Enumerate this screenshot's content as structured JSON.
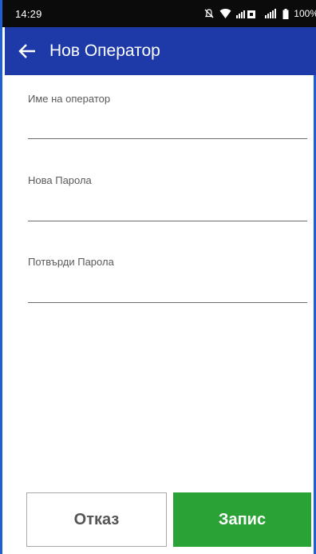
{
  "status_bar": {
    "time": "14:29",
    "battery": "100%",
    "icons": [
      "mute-icon",
      "wifi-icon",
      "signal-icon",
      "signal-icon",
      "battery-icon"
    ]
  },
  "app_bar": {
    "title": "Нов Оператор",
    "back_icon": "arrow-left-icon",
    "color": "#1d3aa8"
  },
  "form": {
    "operator_name": {
      "label": "Име на оператор",
      "value": ""
    },
    "new_password": {
      "label": "Нова Парола",
      "value": ""
    },
    "confirm_password": {
      "label": "Потвърди Парола",
      "value": ""
    }
  },
  "actions": {
    "cancel_label": "Отказ",
    "save_label": "Запис",
    "save_color": "#2aa236"
  }
}
